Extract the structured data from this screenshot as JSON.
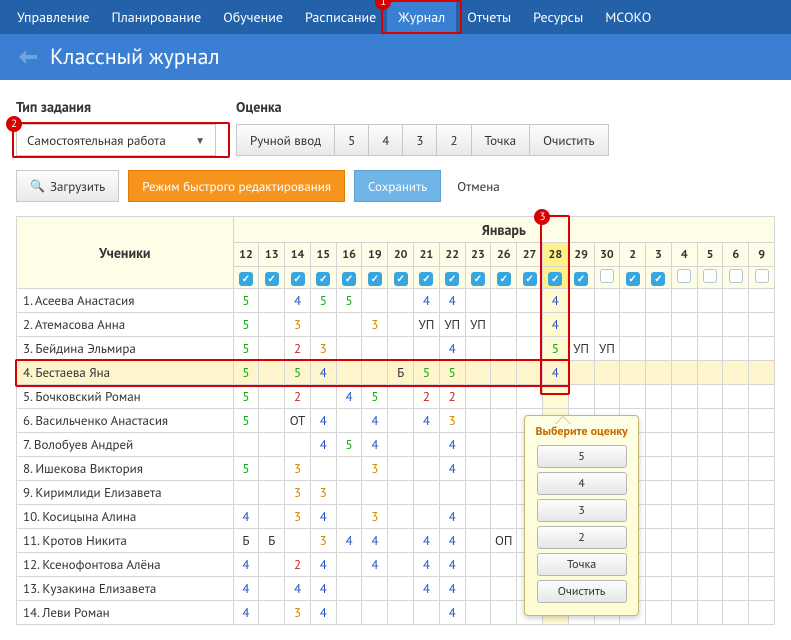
{
  "nav": [
    "Управление",
    "Планирование",
    "Обучение",
    "Расписание",
    "Журнал",
    "Отчеты",
    "Ресурсы",
    "МСОКО"
  ],
  "nav_active": 4,
  "page_title": "Классный журнал",
  "labels": {
    "type": "Тип задания",
    "grade": "Оценка",
    "select_value": "Самостоятельная работа",
    "load": "Загрузить",
    "fastmode": "Режим быстрого редактирования",
    "save": "Сохранить",
    "cancel": "Отмена",
    "students": "Ученики",
    "month": "Январь"
  },
  "grade_buttons": [
    "Ручной ввод",
    "5",
    "4",
    "3",
    "2",
    "Точка",
    "Очистить"
  ],
  "days": [
    12,
    13,
    14,
    15,
    16,
    19,
    20,
    21,
    22,
    23,
    26,
    27,
    28,
    29,
    30,
    2,
    3,
    4,
    5,
    6,
    9
  ],
  "checked": [
    1,
    1,
    1,
    1,
    1,
    1,
    1,
    1,
    1,
    1,
    1,
    1,
    1,
    1,
    0,
    1,
    1,
    0,
    0,
    0,
    0
  ],
  "highlight_col_index": 12,
  "highlight_row_index": 3,
  "students": [
    {
      "name": "1. Асеева Анастасия",
      "g": [
        "5",
        "",
        "4",
        "5",
        "5",
        "",
        "",
        "4",
        "4",
        "",
        "",
        "",
        "4",
        "",
        "",
        "",
        "",
        "",
        "",
        "",
        ""
      ]
    },
    {
      "name": "2. Атемасова Анна",
      "g": [
        "5",
        "",
        "3",
        "",
        "",
        "3",
        "",
        "УП",
        "УП",
        "УП",
        "",
        "",
        "4",
        "",
        "",
        "",
        "",
        "",
        "",
        "",
        ""
      ]
    },
    {
      "name": "3. Бейдина Эльмира",
      "g": [
        "5",
        "",
        "2",
        "3",
        "",
        "",
        "",
        "",
        "4",
        "",
        "",
        "",
        "5",
        "УП",
        "УП",
        "",
        "",
        "",
        "",
        "",
        ""
      ]
    },
    {
      "name": "4. Бестаева Яна",
      "g": [
        "5",
        "",
        "5",
        "4",
        "",
        "",
        "Б",
        "5",
        "5",
        "",
        "",
        "",
        "4",
        "",
        "",
        "",
        "",
        "",
        "",
        "",
        ""
      ]
    },
    {
      "name": "5. Бочковский Роман",
      "g": [
        "5",
        "",
        "2",
        "",
        "4",
        "5",
        "",
        "2",
        "2",
        "",
        "",
        "",
        "",
        "",
        "",
        "",
        "",
        "",
        "",
        "",
        ""
      ]
    },
    {
      "name": "6. Васильченко Анастасия",
      "g": [
        "5",
        "",
        "ОТ",
        "4",
        "",
        "4",
        "",
        "4",
        "3",
        "",
        "",
        "",
        "",
        "",
        "",
        "",
        "",
        "",
        "",
        "",
        ""
      ]
    },
    {
      "name": "7. Волобуев Андрей",
      "g": [
        "",
        "",
        "",
        "4",
        "5",
        "4",
        "",
        "",
        "4",
        "",
        "",
        "",
        "",
        "",
        "",
        "",
        "",
        "",
        "",
        "",
        ""
      ]
    },
    {
      "name": "8. Ишекова Виктория",
      "g": [
        "5",
        "",
        "3",
        "",
        "",
        "3",
        "",
        "",
        "4",
        "",
        "",
        "",
        "",
        "",
        "",
        "",
        "",
        "",
        "",
        "",
        ""
      ]
    },
    {
      "name": "9. Киримлиди Елизавета",
      "g": [
        "",
        "",
        "3",
        "3",
        "",
        "",
        "",
        "",
        "",
        "",
        "",
        "",
        "",
        "",
        "",
        "",
        "",
        "",
        "",
        "",
        ""
      ]
    },
    {
      "name": "10. Косицына Алина",
      "g": [
        "4",
        "",
        "3",
        "4",
        "",
        "3",
        "",
        "",
        "4",
        "",
        "",
        "",
        "",
        "",
        "",
        "",
        "",
        "",
        "",
        "",
        ""
      ]
    },
    {
      "name": "11. Кротов Никита",
      "g": [
        "Б",
        "Б",
        "",
        "3",
        "4",
        "4",
        "",
        "4",
        "4",
        "",
        "ОП",
        "",
        "",
        "",
        "",
        "",
        "",
        "",
        "",
        "",
        ""
      ]
    },
    {
      "name": "12. Ксенофонтова Алёна",
      "g": [
        "4",
        "",
        "2",
        "4",
        "",
        "4",
        "",
        "4",
        "4",
        "",
        "",
        "",
        "",
        "",
        "",
        "",
        "",
        "",
        "",
        "",
        ""
      ]
    },
    {
      "name": "13. Кузакина Елизавета",
      "g": [
        "4",
        "",
        "4",
        "4",
        "",
        "",
        "",
        "4",
        "4",
        "",
        "",
        "",
        "",
        "",
        "",
        "",
        "",
        "",
        "",
        "",
        ""
      ]
    },
    {
      "name": "14. Леви Роман",
      "g": [
        "4",
        "",
        "3",
        "4",
        "",
        "",
        "",
        "",
        "4",
        "",
        "",
        "",
        "",
        "",
        "",
        "",
        "",
        "",
        "",
        "",
        ""
      ]
    }
  ],
  "popup": {
    "title": "Выберите оценку",
    "items": [
      "5",
      "4",
      "3",
      "2",
      "Точка",
      "Очистить"
    ]
  },
  "callouts": {
    "1": "Журнал tab",
    "2": "Тип задания select",
    "3": "day 28 column"
  }
}
